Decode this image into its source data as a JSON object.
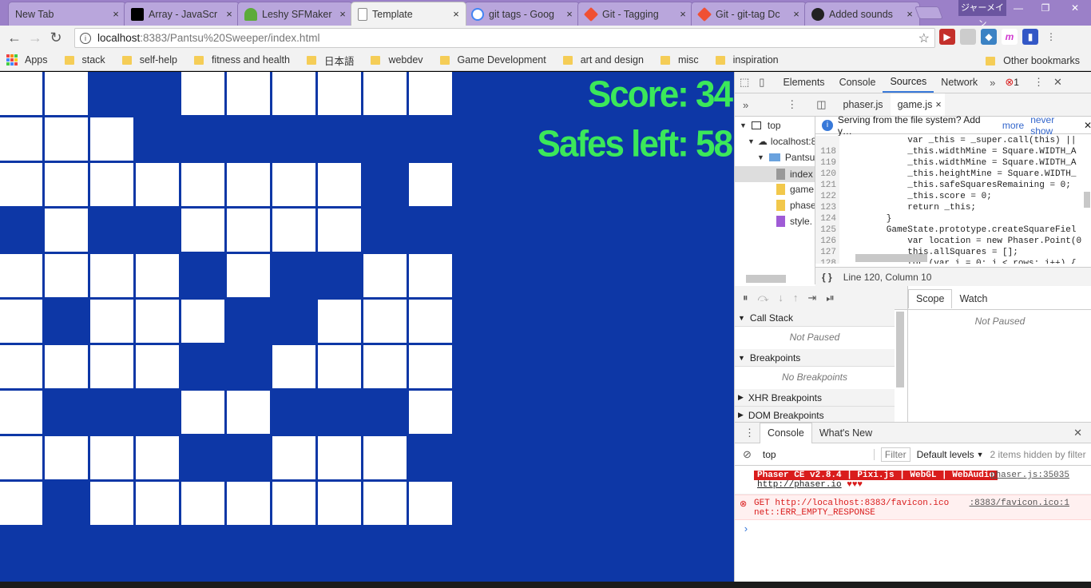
{
  "tabs": [
    {
      "title": "New Tab",
      "favicon": "none",
      "color": ""
    },
    {
      "title": "Array - JavaScr",
      "favicon": "mdn-icon",
      "color": "#000000"
    },
    {
      "title": "Leshy SFMaker",
      "favicon": "tree-icon",
      "color": "#4caf50"
    },
    {
      "title": "Template",
      "favicon": "page-icon",
      "color": "#888888"
    },
    {
      "title": "git tags - Goog",
      "favicon": "google-icon",
      "color": "#4285f4"
    },
    {
      "title": "Git - Tagging",
      "favicon": "git-icon",
      "color": "#f05033"
    },
    {
      "title": "Git - git-tag Dc",
      "favicon": "git-icon",
      "color": "#f05033"
    },
    {
      "title": "Added sounds",
      "favicon": "github-icon",
      "color": "#222222"
    }
  ],
  "ime": "ジャーメイン",
  "window_controls": {
    "minimize": "—",
    "maximize": "❐",
    "close": "✕"
  },
  "omnibox": {
    "host": "localhost",
    "path": ":8383/Pantsu%20Sweeper/index.html",
    "info": "i"
  },
  "bookmarks": {
    "apps": "Apps",
    "items": [
      "stack",
      "self-help",
      "fitness and health",
      "日本語",
      "webdev",
      "Game Development",
      "art and design",
      "misc",
      "inspiration"
    ],
    "other": "Other bookmarks"
  },
  "game": {
    "score": "Score: 34",
    "safes": "Safes left: 58",
    "colors": {
      "background": "#0d37a6",
      "square": "#ffffff",
      "hud": "#3be85a"
    },
    "grid_cols": 10,
    "grid_rows": 10,
    "board": [
      "1100111111",
      "1110000000",
      "1111111101",
      "0100111100",
      "1111010011",
      "1011100111",
      "1111001111",
      "1000110001",
      "1111001110",
      "1011111111"
    ]
  },
  "devtools": {
    "main_tabs": [
      "Elements",
      "Console",
      "Sources",
      "Network"
    ],
    "selected_tab": "Sources",
    "error_count": "1",
    "file_tabs": [
      "phaser.js",
      "game.js"
    ],
    "navigator": {
      "top": "top",
      "host": "localhost:8",
      "folder": "Pantsu",
      "files": [
        "index",
        "game",
        "phase",
        "style."
      ]
    },
    "infobar": {
      "text": "Serving from the file system? Add y…",
      "more": "more",
      "never": "never show"
    },
    "code_lines": [
      {
        "n": "118",
        "t": "            _this.widthMine = Square.WIDTH_A"
      },
      {
        "n": "119",
        "t": "            _this.widthMine = Square.WIDTH_A"
      },
      {
        "n": "120",
        "t": "            _this.heightMine = Square.WIDTH_"
      },
      {
        "n": "121",
        "t": "            _this.safeSquaresRemaining = 0;"
      },
      {
        "n": "122",
        "t": "            _this.score = 0;"
      },
      {
        "n": "123",
        "t": "            return _this;"
      },
      {
        "n": "124",
        "t": "        }"
      },
      {
        "n": "125",
        "t": "        GameState.prototype.createSquareFiel"
      },
      {
        "n": "126",
        "t": "            var location = new Phaser.Point(0"
      },
      {
        "n": "127",
        "t": "            this.allSquares = [];"
      },
      {
        "n": "128",
        "t": "            for (var i = 0; i < rows; i++) {"
      }
    ],
    "code_first_line": "            var _this = _super.call(this) ||",
    "status": "Line 120, Column 10",
    "debug_sections": [
      "Call Stack",
      "Breakpoints",
      "XHR Breakpoints",
      "DOM Breakpoints"
    ],
    "not_paused": "Not Paused",
    "no_breakpoints": "No Breakpoints",
    "scope_tabs": [
      "Scope",
      "Watch"
    ],
    "drawer_tabs": [
      "Console",
      "What's New"
    ],
    "console_context": "top",
    "filter_placeholder": "Filter",
    "levels": "Default levels",
    "hidden": "2 items hidden by filter",
    "messages": [
      {
        "text": "Phaser CE v2.8.4 | Pixi.js | WebGL | WebAudio",
        "link": "http://phaser.io",
        "hearts": "♥♥♥",
        "source": "phaser.js:35035"
      },
      {
        "text": "GET http://localhost:8383/favicon.ico net::ERR_EMPTY_RESPONSE",
        "source": ":8383/favicon.ico:1"
      }
    ],
    "prompt": "›"
  }
}
